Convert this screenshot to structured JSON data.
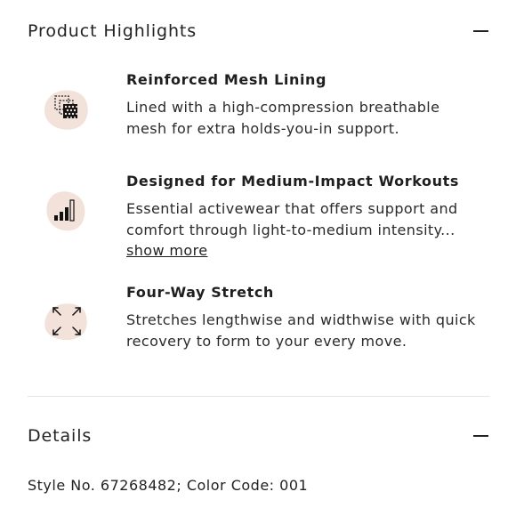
{
  "highlights": {
    "title": "Product Highlights",
    "features": [
      {
        "icon": "mesh-lining-icon",
        "title": "Reinforced Mesh Lining",
        "desc_line1": "Lined with a high-compression breathable",
        "desc_line2": "mesh for extra holds-you-in support."
      },
      {
        "icon": "signal-bars-icon",
        "title": "Designed for Medium-Impact Workouts",
        "desc_line1": "Essential activewear that offers support and",
        "desc_line2": "comfort through light-to-medium intensity...",
        "show_more": "show more"
      },
      {
        "icon": "four-way-stretch-icon",
        "title": "Four-Way Stretch",
        "desc_line1": "Stretches lengthwise and widthwise with quick",
        "desc_line2": "recovery to form to your every move."
      }
    ]
  },
  "details": {
    "title": "Details",
    "style_line": "Style No. 67268482; Color Code: 001"
  },
  "colors": {
    "blob": "#f3e2d9",
    "text": "#1f1f1f",
    "divider": "#e6e2de"
  }
}
